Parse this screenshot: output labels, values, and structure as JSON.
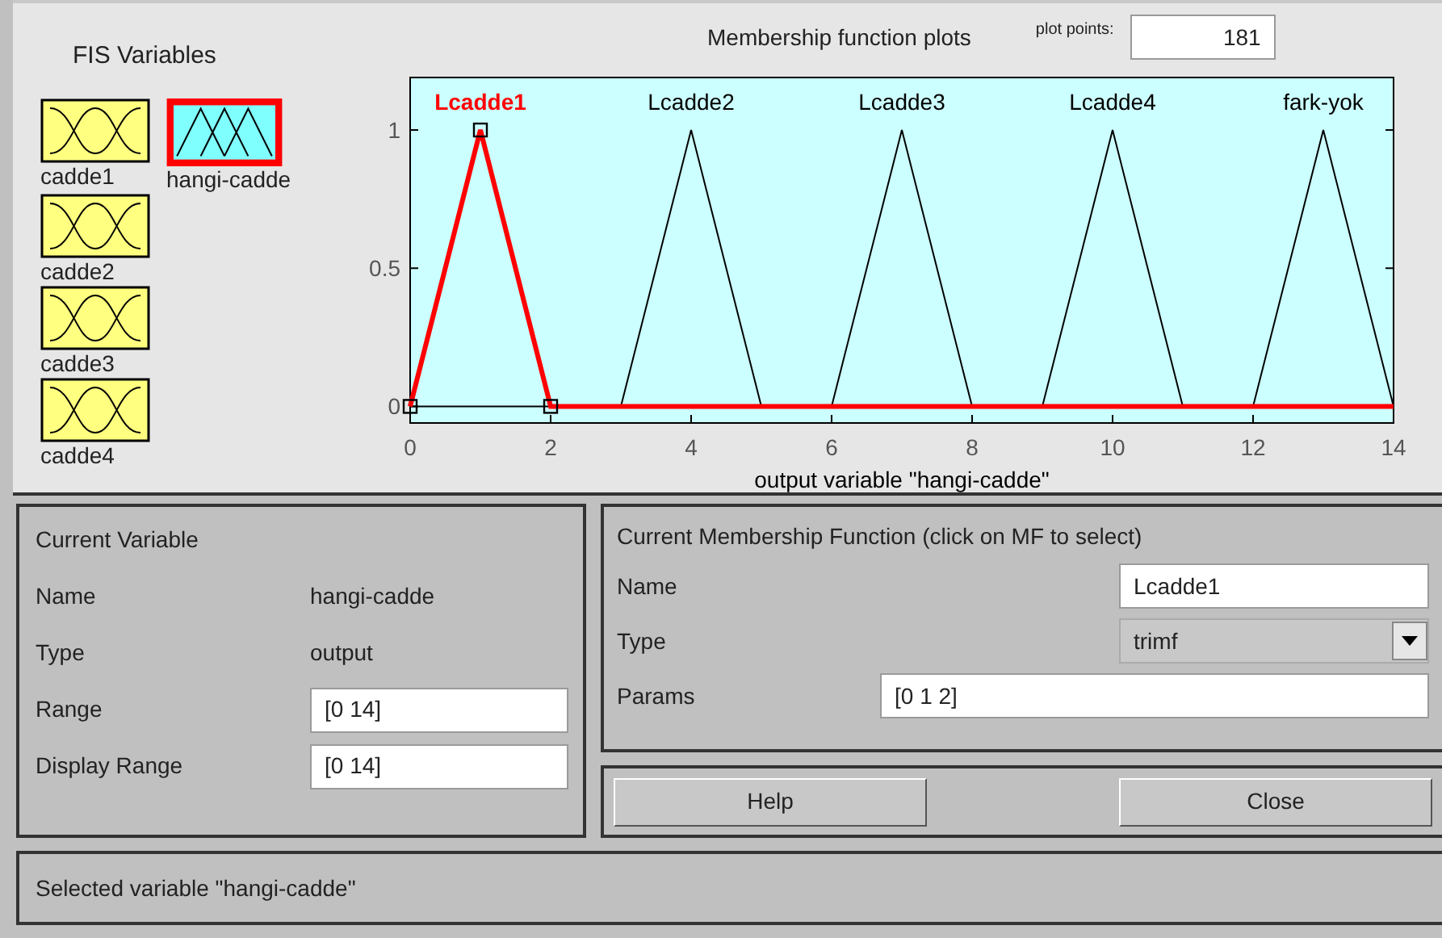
{
  "fis_variables": {
    "title": "FIS Variables",
    "items": [
      {
        "label": "cadde1",
        "kind": "input",
        "selected": false
      },
      {
        "label": "hangi-cadde",
        "kind": "output",
        "selected": true
      },
      {
        "label": "cadde2",
        "kind": "input",
        "selected": false
      },
      {
        "label": "cadde3",
        "kind": "input",
        "selected": false
      },
      {
        "label": "cadde4",
        "kind": "input",
        "selected": false
      }
    ]
  },
  "plot": {
    "title": "Membership function plots",
    "functions": [
      {
        "selected": true
      },
      {
        "selected": false
      },
      {
        "selected": false
      },
      {
        "selected": false
      },
      {
        "selected": false
      }
    ],
    "plot_points": {
      "label": "plot points:",
      "value": "181"
    },
    "chart_data": {
      "type": "line",
      "xlabel": "output variable \"hangi-cadde\"",
      "x": [
        0,
        1,
        2,
        3,
        4,
        5,
        6,
        7,
        8,
        9,
        10,
        11,
        12,
        13,
        14
      ],
      "xlim": [
        0,
        14
      ],
      "ylim": [
        -0.06,
        1.19
      ],
      "xticks": [
        0,
        2,
        4,
        6,
        8,
        10,
        12,
        14
      ],
      "yticks": [
        0,
        {
          "value": 0.5,
          "label": "0.5"
        },
        1
      ],
      "series": [
        {
          "name": "Lcadde1",
          "color": "#ff0000",
          "values": [
            0,
            1,
            0,
            0,
            0,
            0,
            0,
            0,
            0,
            0,
            0,
            0,
            0,
            0,
            0
          ]
        },
        {
          "name": "Lcadde2",
          "color": "#000000",
          "values": [
            null,
            null,
            null,
            0,
            1,
            0,
            null,
            null,
            null,
            null,
            null,
            null,
            null,
            null,
            null
          ]
        },
        {
          "name": "Lcadde3",
          "color": "#000000",
          "values": [
            null,
            null,
            null,
            null,
            null,
            null,
            0,
            1,
            0,
            null,
            null,
            null,
            null,
            null,
            null
          ]
        },
        {
          "name": "Lcadde4",
          "color": "#000000",
          "values": [
            null,
            null,
            null,
            null,
            null,
            null,
            null,
            null,
            null,
            0,
            1,
            0,
            null,
            null,
            null
          ]
        },
        {
          "name": "fark-yok",
          "color": "#000000",
          "values": [
            null,
            null,
            null,
            null,
            null,
            null,
            null,
            null,
            null,
            null,
            null,
            null,
            0,
            1,
            0
          ]
        }
      ]
    }
  },
  "current_variable": {
    "title": "Current Variable",
    "name": {
      "label": "Name",
      "value": "hangi-cadde"
    },
    "type": {
      "label": "Type",
      "value": "output"
    },
    "range": {
      "label": "Range",
      "value": "[0 14]"
    },
    "display_range": {
      "label": "Display Range",
      "value": "[0 14]"
    }
  },
  "current_mf": {
    "title": "Current Membership Function (click on MF to select)",
    "name": {
      "label": "Name",
      "value": "Lcadde1"
    },
    "type": {
      "label": "Type",
      "value": "trimf"
    },
    "params": {
      "label": "Params",
      "value": "[0 1 2]"
    }
  },
  "buttons": [
    "Help",
    "Close"
  ],
  "status": "Selected variable \"hangi-cadde\""
}
